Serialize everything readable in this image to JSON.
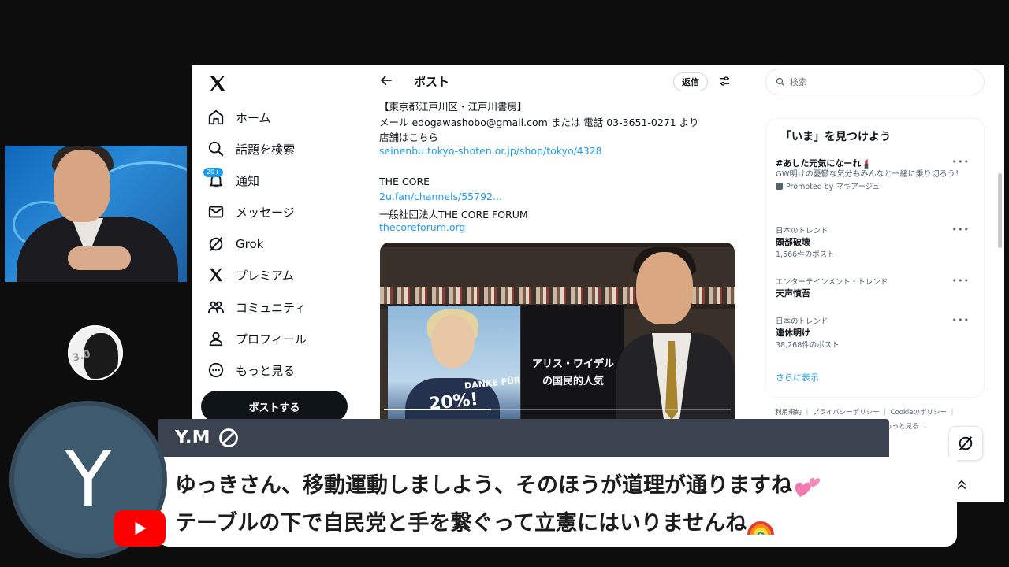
{
  "nav": {
    "items": [
      {
        "label": "ホーム",
        "icon": "home-icon"
      },
      {
        "label": "話題を検索",
        "icon": "search-icon"
      },
      {
        "label": "通知",
        "icon": "bell-icon",
        "badge": "20+"
      },
      {
        "label": "メッセージ",
        "icon": "mail-icon"
      },
      {
        "label": "Grok",
        "icon": "grok-icon"
      },
      {
        "label": "プレミアム",
        "icon": "x-premium-icon"
      },
      {
        "label": "コミュニティ",
        "icon": "community-icon"
      },
      {
        "label": "プロフィール",
        "icon": "profile-icon"
      },
      {
        "label": "もっと見る",
        "icon": "more-circle-icon"
      }
    ],
    "post_button": "ポストする"
  },
  "post": {
    "header_title": "ポスト",
    "reply_button": "返信",
    "lines": [
      {
        "text": "【東京都江戸川区・江戸川書房】",
        "link": false
      },
      {
        "text": "メール edogawashobo@gmail.com または 電話 03-3651-0271 より",
        "link": false
      },
      {
        "text": "店舗はこちら",
        "link": false
      },
      {
        "text": "seinenbu.tokyo-shoten.or.jp/shop/tokyo/4328",
        "link": true
      },
      {
        "text": "THE CORE",
        "link": false
      },
      {
        "text": "2u.fan/channels/55792...",
        "link": true
      },
      {
        "text": "一般社団法人THE CORE FORUM",
        "link": false
      },
      {
        "text": "thecoreforum.org",
        "link": true
      }
    ],
    "video": {
      "board_line1": "アリス・ワイデル",
      "board_line2": "の国民的人気",
      "poster_text": "DANKE FÜR",
      "poster_pct": "20%!",
      "progress": 0.31
    }
  },
  "sidebar": {
    "search_placeholder": "検索",
    "trends_title": "「いま」を見つけよう",
    "trends": [
      {
        "name": "#あした元気になーれ",
        "desc": "GW明けの憂鬱な気分もみんなと一緒に乗り切ろう！",
        "promo": "Promoted by マキアージュ"
      },
      {
        "meta": "日本のトレンド",
        "name": "頭部破壊",
        "count": "1,566件のポスト"
      },
      {
        "meta": "エンターテインメント・トレンド",
        "name": "天声慎吾"
      },
      {
        "meta": "日本のトレンド",
        "name": "連休明け",
        "count": "38,268件のポスト"
      }
    ],
    "show_more": "さらに表示",
    "footer_links": "利用規約 ｜ プライバシーポリシー ｜ Cookieのポリシー ｜",
    "footer_more": "もっと見る …"
  },
  "overlay": {
    "logo_text": "3.0"
  },
  "chat": {
    "avatar_letter": "Y",
    "username": "Y.M",
    "line1": "ゆっきさん、移動運動しましよう、そのほうが道理が通りますね",
    "line2": "テーブルの下で自民党と手を繋ぐって立憲にはいりませんね"
  },
  "colors": {
    "accent": "#1d9bf0",
    "chat_name_bar": "#3b4350",
    "youtube_red": "#ff0000"
  }
}
